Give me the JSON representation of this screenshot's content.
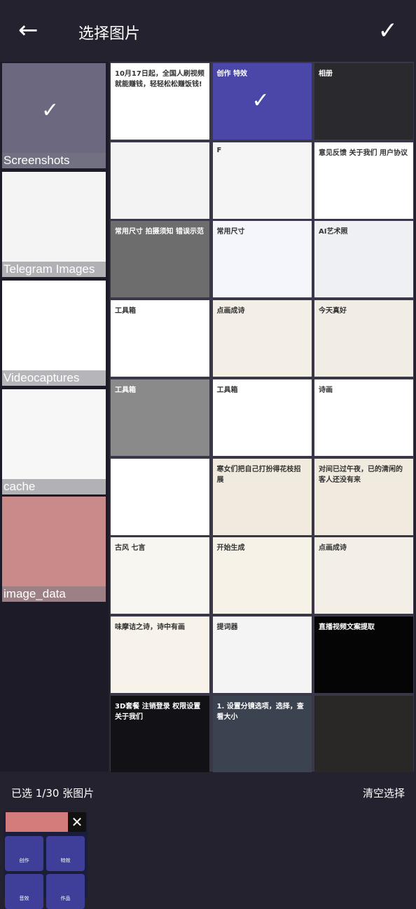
{
  "header": {
    "title": "选择图片",
    "back_icon": "arrow-left-icon",
    "confirm_icon": "check-icon"
  },
  "folders": [
    {
      "name": "Screenshots",
      "color": "#6c6880",
      "selected": true
    },
    {
      "name": "Telegram Images",
      "color": "#f4f4f4"
    },
    {
      "name": "Videocaptures",
      "color": "#ffffff"
    },
    {
      "name": "cache",
      "color": "#f7f7f7"
    },
    {
      "name": "image_data",
      "color": "#c98a8a"
    }
  ],
  "tiles": [
    {
      "text": "10月17日起，全国人刷视频就能赚钱，轻轻松松赚饭钱!",
      "bg": "#ffffff"
    },
    {
      "text": "创作  特效",
      "bg": "#4a47a8",
      "selected": true
    },
    {
      "text": "相册",
      "bg": "#2a2a2e"
    },
    {
      "text": "",
      "bg": "#f3f3f3"
    },
    {
      "text": "F",
      "bg": "#f5f5f5"
    },
    {
      "text": "意见反馈  关于我们  用户协议",
      "bg": "#ffffff"
    },
    {
      "text": "常用尺寸  拍摄须知  错误示范",
      "bg": "#6d6d6d"
    },
    {
      "text": "常用尺寸",
      "bg": "#f4f6fb"
    },
    {
      "text": "AI艺术照",
      "bg": "#eef0f4"
    },
    {
      "text": "工具箱",
      "bg": "#ffffff"
    },
    {
      "text": "点画成诗",
      "bg": "#f3efe6"
    },
    {
      "text": "今天真好",
      "bg": "#f1ede5"
    },
    {
      "text": "工具箱",
      "bg": "#8a8a8a"
    },
    {
      "text": "工具箱",
      "bg": "#ffffff"
    },
    {
      "text": "诗画",
      "bg": "#ffffff"
    },
    {
      "text": "",
      "bg": "#ffffff"
    },
    {
      "text": "寒女们把自己打扮得花枝招展",
      "bg": "#f1ebdf"
    },
    {
      "text": "对间已过午夜，已的清闲的客人还没有来",
      "bg": "#f1ebdf"
    },
    {
      "text": "古风  七言",
      "bg": "#f8f6f0"
    },
    {
      "text": "开始生成",
      "bg": "#f7f2e8"
    },
    {
      "text": "点画成诗",
      "bg": "#f3efe6"
    },
    {
      "text": "味摩诘之诗，诗中有画",
      "bg": "#f7f3ea"
    },
    {
      "text": "提词器",
      "bg": "#f4f4f4"
    },
    {
      "text": "直播视频文案提取",
      "bg": "#050505"
    },
    {
      "text": "3D套餐  注销登录  权限设置  关于我们",
      "bg": "#111116"
    },
    {
      "text": "1. 设置分镜选项，选择，查看大小",
      "bg": "#3c4350"
    },
    {
      "text": "",
      "bg": "#2a2826"
    }
  ],
  "footer": {
    "count": "已选 1/30 张图片",
    "clear": "清空选择",
    "remove_icon": "close-icon",
    "thumb_buttons": [
      "创作",
      "特效",
      "音效",
      "作品"
    ]
  }
}
